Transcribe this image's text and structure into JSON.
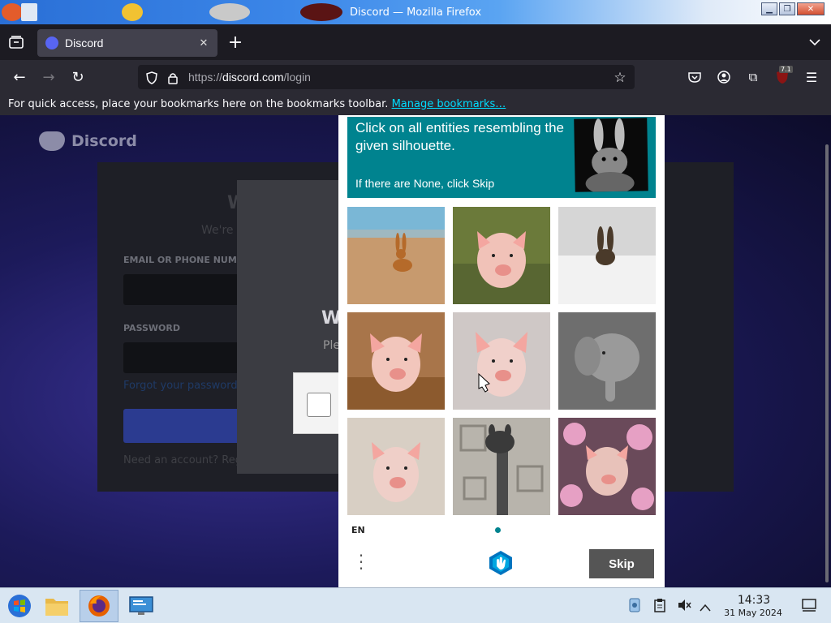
{
  "window": {
    "title": "Discord — Mozilla Firefox",
    "buttons": [
      "minimize",
      "maximize",
      "close"
    ]
  },
  "tabs": [
    {
      "label": "Discord",
      "close_label": "✕",
      "active": true
    }
  ],
  "new_tab_label": "+",
  "nav": {
    "url_prefix": "https://",
    "url_domain": "discord.com",
    "url_path": "/login",
    "extensions_badge": "7.1"
  },
  "bookmarks_bar": {
    "message": "For quick access, place your bookmarks here on the bookmarks toolbar.",
    "link": "Manage bookmarks…"
  },
  "page": {
    "brand": "Discord",
    "email_label": "EMAIL OR PHONE NUMB",
    "password_label": "PASSWORD",
    "forgot_password": "Forgot your password?",
    "need_account": "Need an account? Reg",
    "welcome_partial": "W",
    "subtitle_partial": "We're",
    "dialog_title_partial": "W",
    "dialog_sub_partial": "Ple"
  },
  "captcha": {
    "prompt": "Click on all entities resembling the given silhouette.",
    "hint": "If there are None, click Skip",
    "sample": "rabbit",
    "tiles": [
      {
        "subject": "rabbit on sand"
      },
      {
        "subject": "pig in grass"
      },
      {
        "subject": "rabbit on bed"
      },
      {
        "subject": "pig on leaves"
      },
      {
        "subject": "pig"
      },
      {
        "subject": "elephant"
      },
      {
        "subject": "pig"
      },
      {
        "subject": "giraffe"
      },
      {
        "subject": "pig with flowers"
      }
    ],
    "language": "EN",
    "skip_label": "Skip"
  },
  "taskbar": {
    "time": "14:33",
    "date": "31 May 2024"
  },
  "colors": {
    "captcha_teal": "#00838f",
    "firefox_tab_bg": "#42414d",
    "link_color": "#00ddff"
  }
}
